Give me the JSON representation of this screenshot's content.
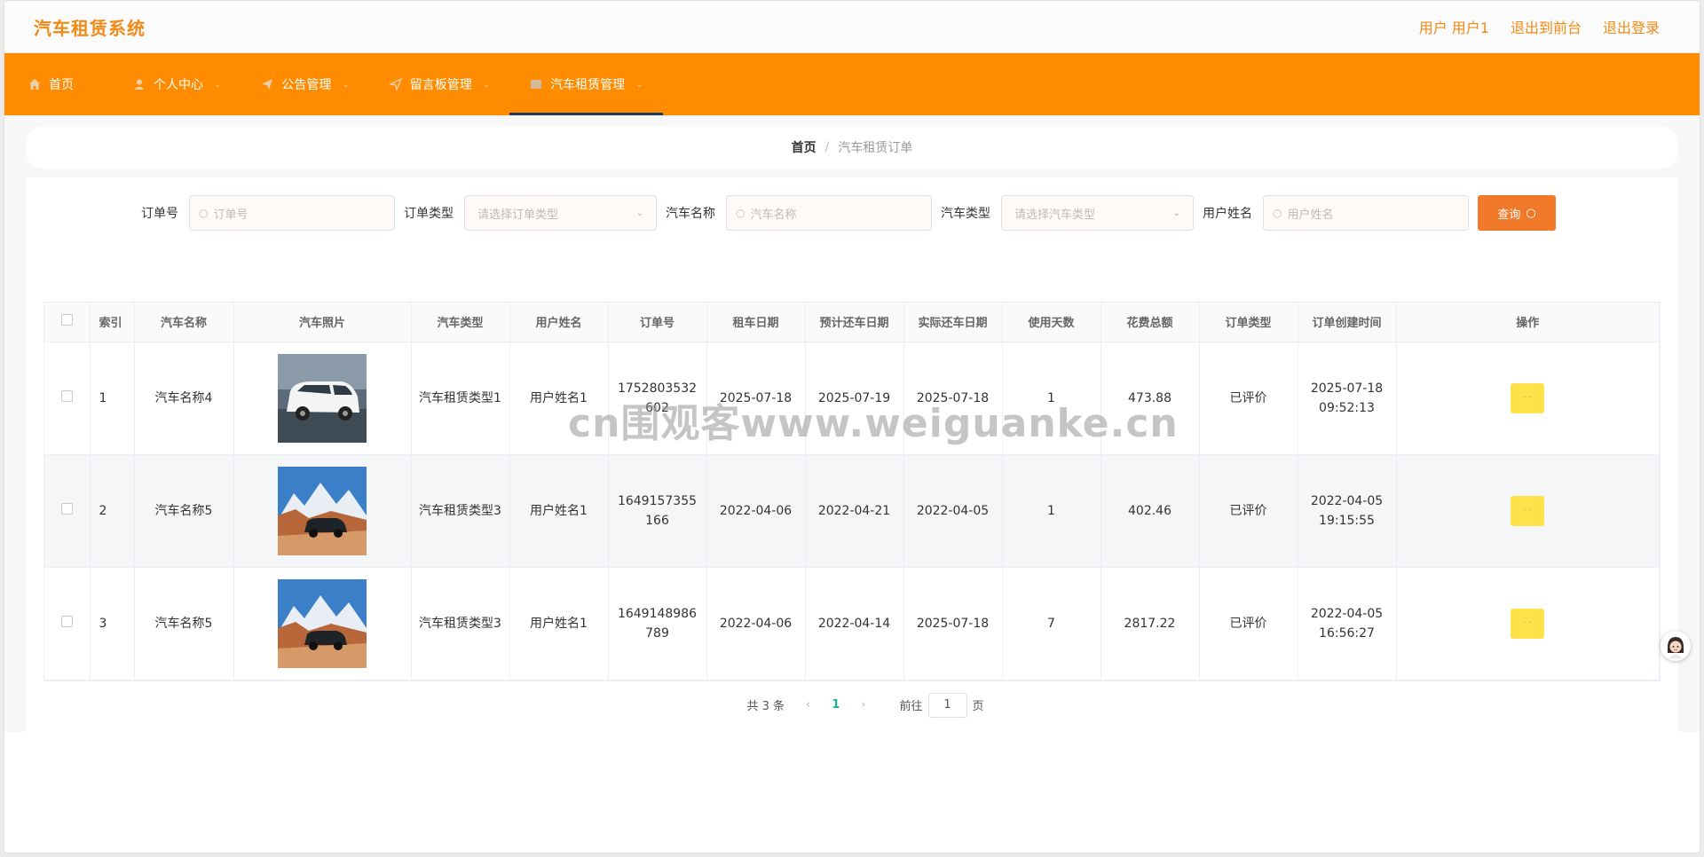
{
  "header": {
    "title": "汽车租赁系统",
    "user_label": "用户 用户1",
    "back_front": "退出到前台",
    "logout": "退出登录"
  },
  "nav": {
    "items": [
      {
        "label": "首页",
        "icon": "home-icon"
      },
      {
        "label": "个人中心",
        "icon": "user-icon"
      },
      {
        "label": "公告管理",
        "icon": "send-icon"
      },
      {
        "label": "留言板管理",
        "icon": "navigation-icon"
      },
      {
        "label": "汽车租赁管理",
        "icon": "grid-icon"
      }
    ],
    "active": 4
  },
  "breadcrumb": {
    "home": "首页",
    "sep": "/",
    "current": "汽车租赁订单"
  },
  "search": {
    "order_no_label": "订单号",
    "order_no_placeholder": "订单号",
    "order_type_label": "订单类型",
    "order_type_placeholder": "请选择订单类型",
    "car_name_label": "汽车名称",
    "car_name_placeholder": "汽车名称",
    "car_type_label": "汽车类型",
    "car_type_placeholder": "请选择汽车类型",
    "user_name_label": "用户姓名",
    "user_name_placeholder": "用户姓名",
    "query_button": "查询"
  },
  "table": {
    "headers": [
      "索引",
      "汽车名称",
      "汽车照片",
      "汽车类型",
      "用户姓名",
      "订单号",
      "租车日期",
      "预计还车日期",
      "实际还车日期",
      "使用天数",
      "花费总额",
      "订单类型",
      "订单创建时间",
      "操作"
    ],
    "rows": [
      {
        "index": "1",
        "car_name": "汽车名称4",
        "car_type": "汽车租赁类型1",
        "user_name": "用户姓名1",
        "order_no": "1752803532602",
        "rent_date": "2025-07-18",
        "expected_return": "2025-07-19",
        "actual_return": "2025-07-18",
        "days": "1",
        "total": "473.88",
        "order_type": "已评价",
        "created": "2025-07-18 09:52:13",
        "op": "· ·"
      },
      {
        "index": "2",
        "car_name": "汽车名称5",
        "car_type": "汽车租赁类型3",
        "user_name": "用户姓名1",
        "order_no": "1649157355166",
        "rent_date": "2022-04-06",
        "expected_return": "2022-04-21",
        "actual_return": "2022-04-05",
        "days": "1",
        "total": "402.46",
        "order_type": "已评价",
        "created": "2022-04-05 19:15:55",
        "op": "· ·"
      },
      {
        "index": "3",
        "car_name": "汽车名称5",
        "car_type": "汽车租赁类型3",
        "user_name": "用户姓名1",
        "order_no": "1649148986789",
        "rent_date": "2022-04-06",
        "expected_return": "2022-04-14",
        "actual_return": "2025-07-18",
        "days": "7",
        "total": "2817.22",
        "order_type": "已评价",
        "created": "2022-04-05 16:56:27",
        "op": "· ·"
      }
    ]
  },
  "pagination": {
    "total": "共 3 条",
    "prev": "‹",
    "page": "1",
    "next": "›",
    "goto_label": "前往",
    "goto_value": "1",
    "page_suffix": "页"
  },
  "watermark": "cn围观客www.weiguanke.cn",
  "colors": {
    "accent": "#ff8c00",
    "title": "#f08a16",
    "query": "#f07a2a",
    "op": "#ffe14a"
  }
}
